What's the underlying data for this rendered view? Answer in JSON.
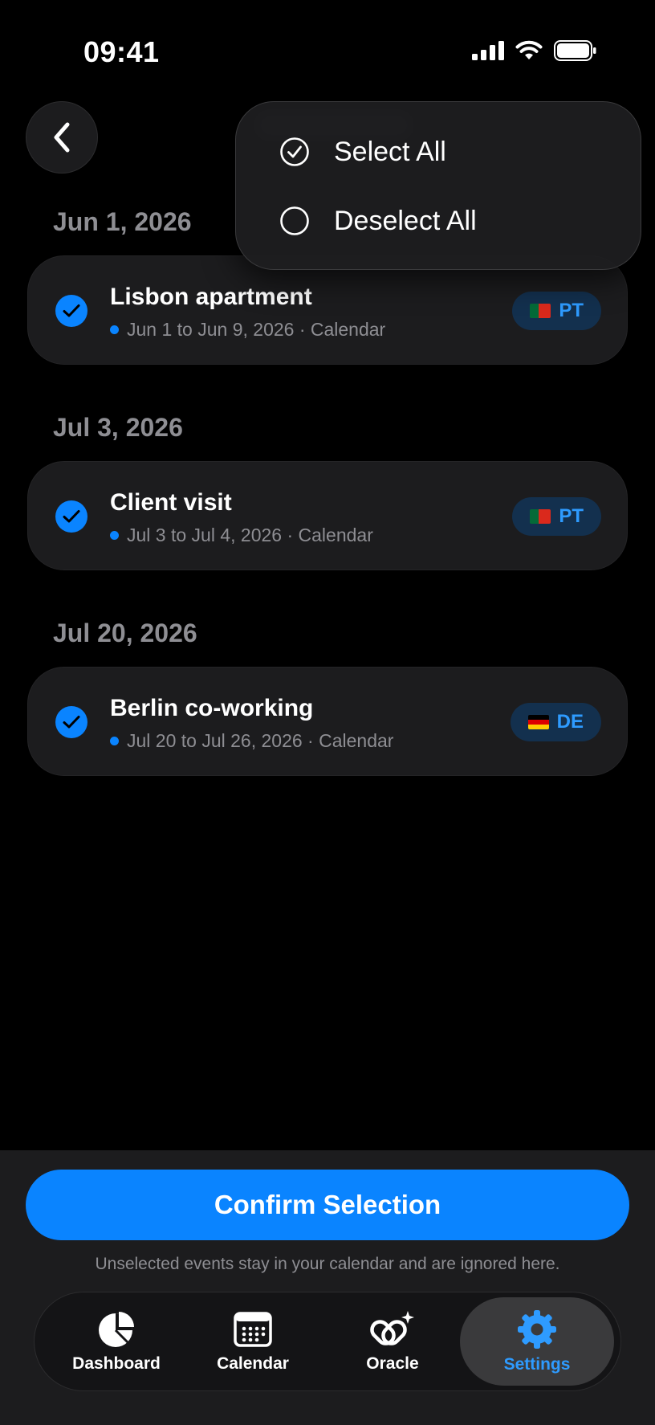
{
  "status_bar": {
    "time": "09:41"
  },
  "menu": {
    "items": [
      {
        "label": "Select All",
        "icon": "checkmark-circle-icon"
      },
      {
        "label": "Deselect All",
        "icon": "empty-circle-icon"
      }
    ]
  },
  "sections": [
    {
      "date": "Jun 1, 2026",
      "event": {
        "title": "Lisbon apartment",
        "subtitle": "Jun 1 to Jun 9, 2026 · Calendar",
        "country": "PT",
        "selected": true
      }
    },
    {
      "date": "Jul 3, 2026",
      "event": {
        "title": "Client visit",
        "subtitle": "Jul 3 to Jul 4, 2026 · Calendar",
        "country": "PT",
        "selected": true
      }
    },
    {
      "date": "Jul 20, 2026",
      "event": {
        "title": "Berlin co-working",
        "subtitle": "Jul 20 to Jul 26, 2026 · Calendar",
        "country": "DE",
        "selected": true
      }
    }
  ],
  "confirm": {
    "label": "Confirm Selection",
    "helper": "Unselected events stay in your calendar and are ignored here."
  },
  "tabs": [
    {
      "label": "Dashboard",
      "icon": "pie-chart-icon",
      "active": false
    },
    {
      "label": "Calendar",
      "icon": "calendar-icon",
      "active": false
    },
    {
      "label": "Oracle",
      "icon": "oracle-sparkle-icon",
      "active": false
    },
    {
      "label": "Settings",
      "icon": "gear-icon",
      "active": true
    }
  ],
  "colors": {
    "accent": "#0a84ff",
    "background": "#000000",
    "card": "#1c1c1e",
    "secondary_text": "#8e8e93"
  }
}
